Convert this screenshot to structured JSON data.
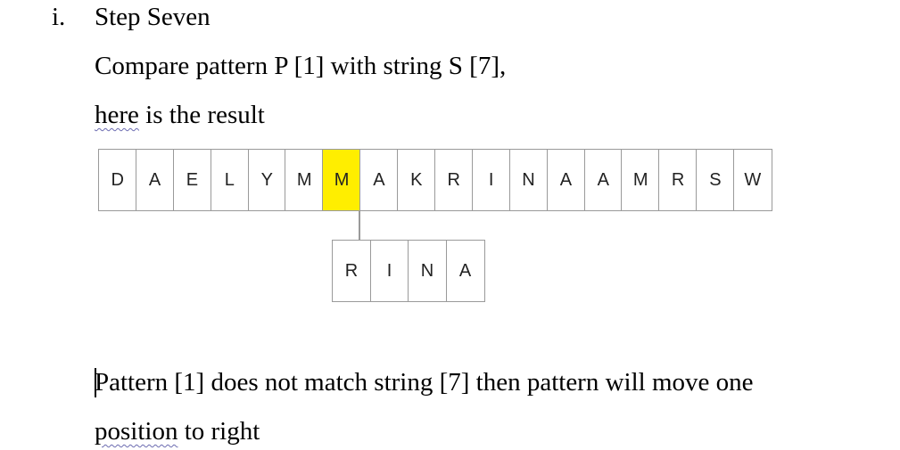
{
  "list_marker": "i.",
  "heading": "Step Seven",
  "line1": "Compare pattern P [1] with string S [7],",
  "line2_underlined": "here",
  "line2_rest": " is the result",
  "string_cells": [
    "D",
    "A",
    "E",
    "L",
    "Y",
    "M",
    "M",
    "A",
    "K",
    "R",
    "I",
    "N",
    "A",
    "A",
    "M",
    "R",
    "S",
    "W"
  ],
  "highlight_index": 6,
  "highlight_color": "#ffee00",
  "pattern_cells": [
    "R",
    "I",
    "N",
    "A"
  ],
  "para1": "Pattern [1] does not match string [7] then pattern will move one",
  "para2_underlined": "position",
  "para2_rest": " to right"
}
